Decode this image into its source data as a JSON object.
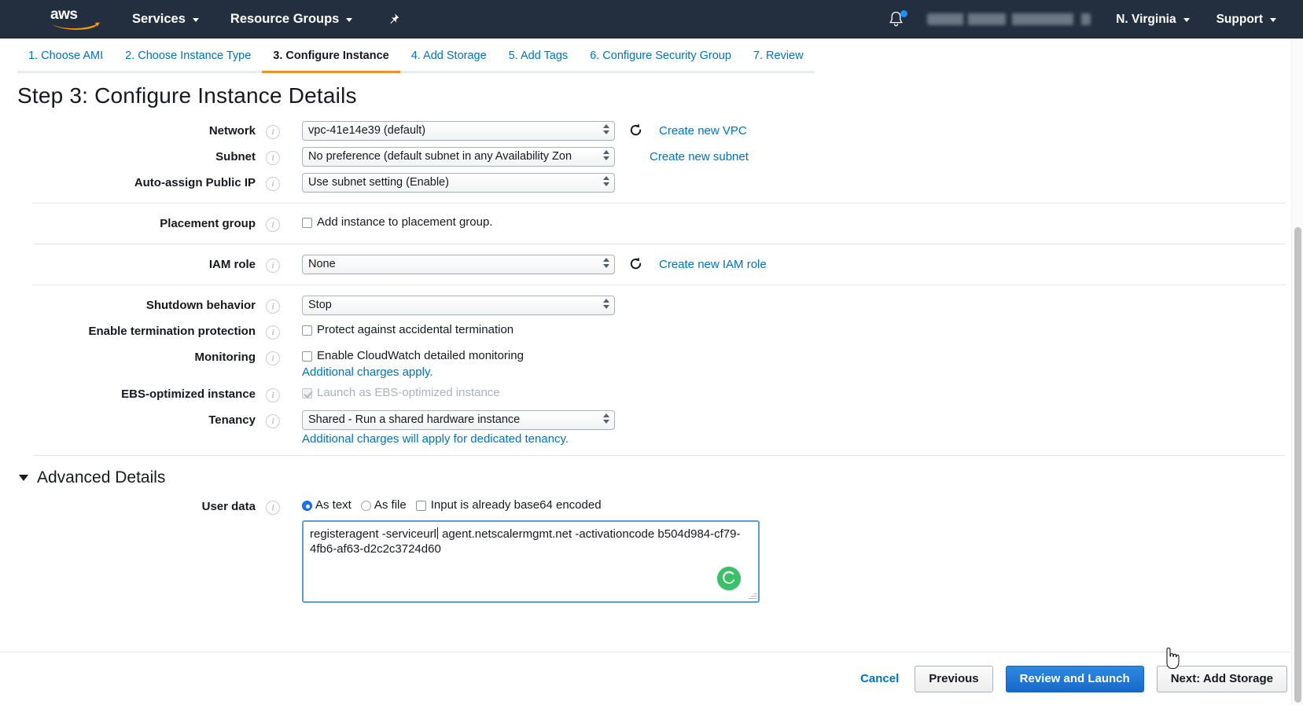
{
  "navbar": {
    "logo_alt": "aws-logo",
    "services_label": "Services",
    "resource_groups_label": "Resource Groups",
    "pin_icon": "pin-icon",
    "bell_icon": "notifications-bell-icon",
    "account_label": "",
    "region_label": "N. Virginia",
    "support_label": "Support"
  },
  "wizard": {
    "tabs": [
      {
        "label": "1. Choose AMI",
        "active": false
      },
      {
        "label": "2. Choose Instance Type",
        "active": false
      },
      {
        "label": "3. Configure Instance",
        "active": true
      },
      {
        "label": "4. Add Storage",
        "active": false
      },
      {
        "label": "5. Add Tags",
        "active": false
      },
      {
        "label": "6. Configure Security Group",
        "active": false
      },
      {
        "label": "7. Review",
        "active": false
      }
    ],
    "active_tab_index": 2,
    "accent_color": "#ec912d"
  },
  "page": {
    "title": "Step 3: Configure Instance Details"
  },
  "fields": {
    "network": {
      "label": "Network",
      "value": "vpc-41e14e39 (default)",
      "refresh_icon": "refresh-icon",
      "link": "Create new VPC"
    },
    "subnet": {
      "label": "Subnet",
      "value": "No preference (default subnet in any Availability Zon",
      "link": "Create new subnet"
    },
    "auto_assign_public_ip": {
      "label": "Auto-assign Public IP",
      "value": "Use subnet setting (Enable)"
    },
    "placement_group": {
      "label": "Placement group",
      "checkbox_label": "Add instance to placement group.",
      "checked": false
    },
    "iam_role": {
      "label": "IAM role",
      "value": "None",
      "refresh_icon": "refresh-icon",
      "link": "Create new IAM role"
    },
    "shutdown_behavior": {
      "label": "Shutdown behavior",
      "value": "Stop"
    },
    "termination_protection": {
      "label": "Enable termination protection",
      "checkbox_label": "Protect against accidental termination",
      "checked": false
    },
    "monitoring": {
      "label": "Monitoring",
      "checkbox_label": "Enable CloudWatch detailed monitoring",
      "checked": false,
      "link": "Additional charges apply."
    },
    "ebs_optimized": {
      "label": "EBS-optimized instance",
      "checkbox_label": "Launch as EBS-optimized instance",
      "checked": true,
      "disabled": true
    },
    "tenancy": {
      "label": "Tenancy",
      "value": "Shared - Run a shared hardware instance",
      "link": "Additional charges will apply for dedicated tenancy."
    }
  },
  "advanced": {
    "title": "Advanced Details",
    "expanded": true,
    "user_data": {
      "label": "User data",
      "radio_as_text": "As text",
      "radio_as_file": "As file",
      "selected_mode": "As text",
      "base64_checkbox_label": "Input is already base64 encoded",
      "base64_checked": false,
      "value_part1": "registeragent -serviceurl",
      "value_part2": " agent.netscalermgmt.net -activationcode b504d984-cf79-4fb6-af63-d2c2c3724d60",
      "full_value": "registeragent -serviceurl agent.netscalermgmt.net -activationcode b504d984-cf79-4fb6-af63-d2c2c3724d60",
      "badge_icon": "grammar-assistant-badge-icon",
      "badge_color": "#3cbf69"
    }
  },
  "footer": {
    "cancel_label": "Cancel",
    "previous_label": "Previous",
    "review_launch_label": "Review and Launch",
    "next_label": "Next: Add Storage",
    "primary_color": "#1768c9"
  }
}
